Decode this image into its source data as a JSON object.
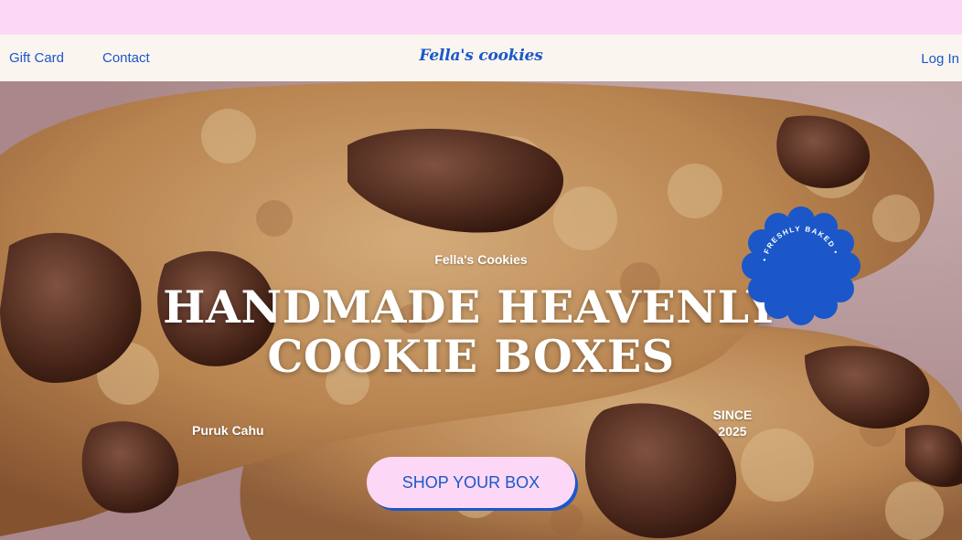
{
  "nav": {
    "links": [
      "Gift Card",
      "Contact"
    ],
    "brand": "Fella's cookies",
    "login": "Log In"
  },
  "hero": {
    "eyebrow": "Fella's Cookies",
    "headline_line1": "HANDMADE HEAVENLY",
    "headline_line2": "COOKIE BOXES",
    "location": "Puruk Cahu",
    "since_line1": "SINCE",
    "since_line2": "2025",
    "cta": "SHOP YOUR BOX",
    "badge_text": "• FRESHLY BAKED •"
  },
  "colors": {
    "accent": "#1b57c9",
    "pink": "#fdd8f6",
    "navbar_bg": "#faf5ef"
  }
}
